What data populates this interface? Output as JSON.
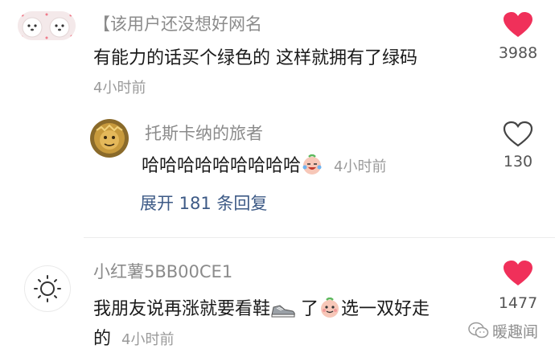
{
  "comments": [
    {
      "username": "【该用户还没想好网名",
      "content": "有能力的话买个绿色的 这样就拥有了绿码",
      "time": "4小时前",
      "likes": "3988",
      "liked": true
    },
    {
      "username": "小红薯5BB00CE1",
      "content_line1": "我朋友说再涨就要看鞋",
      "content_mid": "了",
      "content_tail": "选一双好走",
      "content_line2": "的",
      "time": "4小时前",
      "likes": "1477",
      "liked": true
    }
  ],
  "reply": {
    "username": "托斯卡纳的旅者",
    "content": "哈哈哈哈哈哈哈哈哈",
    "time": "4小时前",
    "likes": "130",
    "liked": false
  },
  "expand_label": "展开 181 条回复",
  "watermark": "暖趣闻",
  "colors": {
    "like_red": "#f0305a",
    "link_blue": "#3d5a86"
  },
  "icons": [
    "heart-filled-icon",
    "heart-outline-icon",
    "sun-icon",
    "sneaker-emoji",
    "peach-face-emoji",
    "wechat-logo-icon"
  ]
}
